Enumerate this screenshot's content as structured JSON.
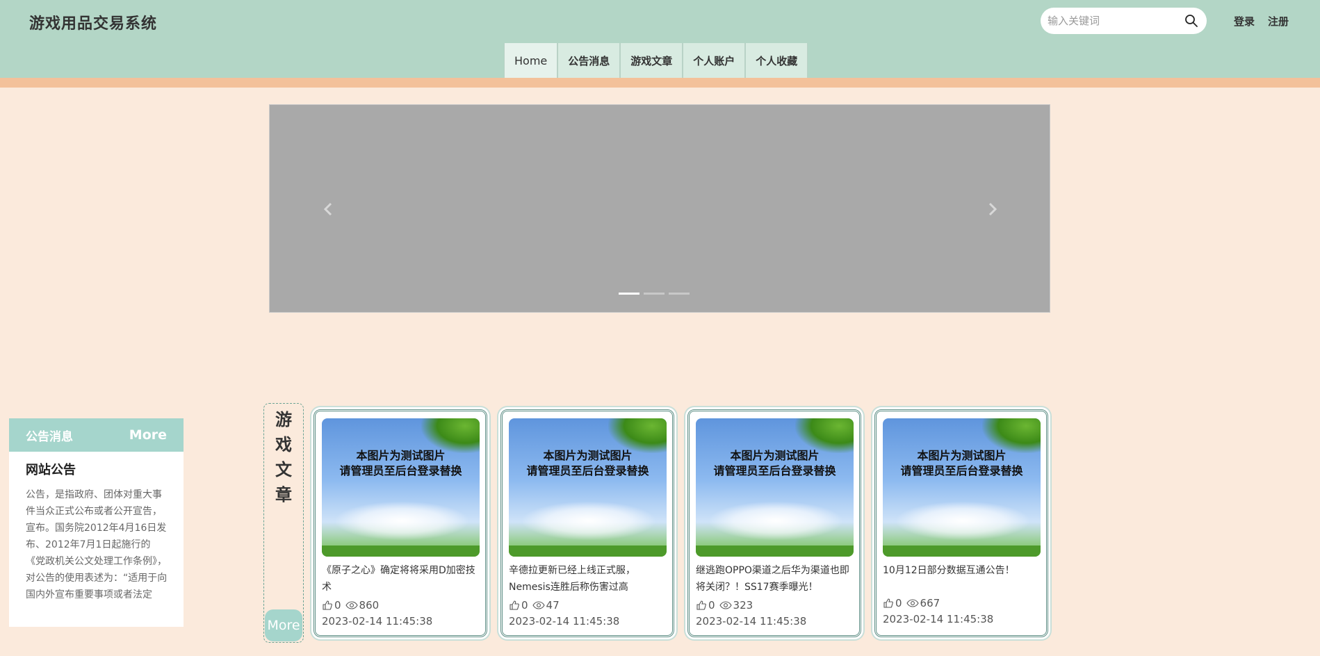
{
  "header": {
    "site_title": "游戏用品交易系统",
    "search_placeholder": "输入关键词",
    "login": "登录",
    "register": "注册",
    "icons": {
      "search": "search-icon"
    },
    "colors": {
      "bar": "#b3d6c6",
      "stripe": "#f3c19a",
      "page_bg": "#fbeadc"
    }
  },
  "nav": {
    "items": [
      {
        "label": "Home"
      },
      {
        "label": "公告消息"
      },
      {
        "label": "游戏文章"
      },
      {
        "label": "个人账户"
      },
      {
        "label": "个人收藏"
      }
    ]
  },
  "carousel": {
    "slide_count": 3,
    "active_index": 0,
    "icons": {
      "prev": "chevron-left-icon",
      "next": "chevron-right-icon"
    }
  },
  "notice": {
    "header_label": "公告消息",
    "more": "More",
    "title": "网站公告",
    "body": "公告，是指政府、团体对重大事件当众正式公布或者公开宣告，宣布。国务院2012年4月16日发布、2012年7月1日起施行的《党政机关公文处理工作条例》，对公告的使用表述为：“适用于向国内外宣布重要事项或者法定",
    "accent": "#a5d5cc"
  },
  "articles_section": {
    "label_chars": [
      "游",
      "戏",
      "文",
      "章"
    ],
    "more": "More"
  },
  "articles": [
    {
      "title": "《原子之心》确定将将采用D加密技术",
      "likes": "0",
      "views": "860",
      "date": "2023-02-14 11:45:38",
      "image_caption_1": "本图片为测试图片",
      "image_caption_2": "请管理员至后台登录替换"
    },
    {
      "title": "辛德拉更新已经上线正式服，Nemesis连胜后称伤害过高",
      "likes": "0",
      "views": "47",
      "date": "2023-02-14 11:45:38",
      "image_caption_1": "本图片为测试图片",
      "image_caption_2": "请管理员至后台登录替换"
    },
    {
      "title": "继逃跑OPPO渠道之后华为渠道也即将关闭？！SS17赛季曝光！",
      "likes": "0",
      "views": "323",
      "date": "2023-02-14 11:45:38",
      "image_caption_1": "本图片为测试图片",
      "image_caption_2": "请管理员至后台登录替换"
    },
    {
      "title": "10月12日部分数据互通公告！",
      "likes": "0",
      "views": "667",
      "date": "2023-02-14 11:45:38",
      "image_caption_1": "本图片为测试图片",
      "image_caption_2": "请管理员至后台登录替换"
    }
  ],
  "card_icons": {
    "likes": "thumbs-up-icon",
    "views": "eye-icon"
  }
}
